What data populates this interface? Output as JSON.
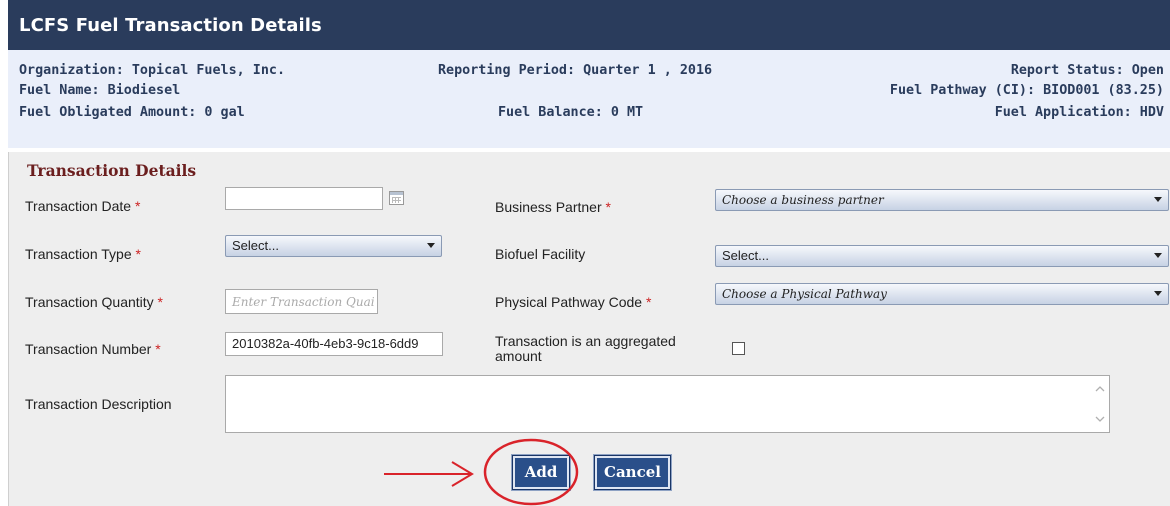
{
  "window": {
    "title": "LCFS Fuel Transaction Details"
  },
  "info": {
    "organization": "Organization: Topical Fuels, Inc.",
    "reporting_period": "Reporting Period: Quarter 1 , 2016",
    "report_status": "Report Status: Open",
    "fuel_name": "Fuel Name: Biodiesel",
    "fuel_pathway": "Fuel Pathway (CI): BIOD001 (83.25)",
    "fuel_obligated": "Fuel Obligated Amount: 0 gal",
    "fuel_balance": "Fuel Balance: 0 MT",
    "fuel_application": "Fuel Application: HDV"
  },
  "form": {
    "section_title": "Transaction Details",
    "required_mark": "*",
    "transaction_date": {
      "label": "Transaction Date",
      "value": ""
    },
    "business_partner": {
      "label": "Business Partner",
      "selected": "Choose a business partner"
    },
    "transaction_type": {
      "label": "Transaction Type",
      "selected": "Select..."
    },
    "biofuel_facility": {
      "label": "Biofuel Facility",
      "selected": "Select..."
    },
    "transaction_quantity": {
      "label": "Transaction Quantity",
      "placeholder": "Enter Transaction Quai"
    },
    "physical_pathway": {
      "label": "Physical Pathway Code",
      "selected": "Choose a Physical Pathway"
    },
    "transaction_number": {
      "label": "Transaction Number",
      "value": "2010382a-40fb-4eb3-9c18-6dd9"
    },
    "aggregated": {
      "label": "Transaction is an aggregated amount",
      "checked": false
    },
    "description": {
      "label": "Transaction Description",
      "value": ""
    }
  },
  "buttons": {
    "add": "Add",
    "cancel": "Cancel"
  },
  "colors": {
    "header": "#2a3c5c",
    "info_bg": "#eaeffa",
    "form_bg": "#eeeeee",
    "section_title": "#6b1e1e",
    "button": "#2a4f8a",
    "required": "#cc2222",
    "annotation": "#d9232a"
  }
}
